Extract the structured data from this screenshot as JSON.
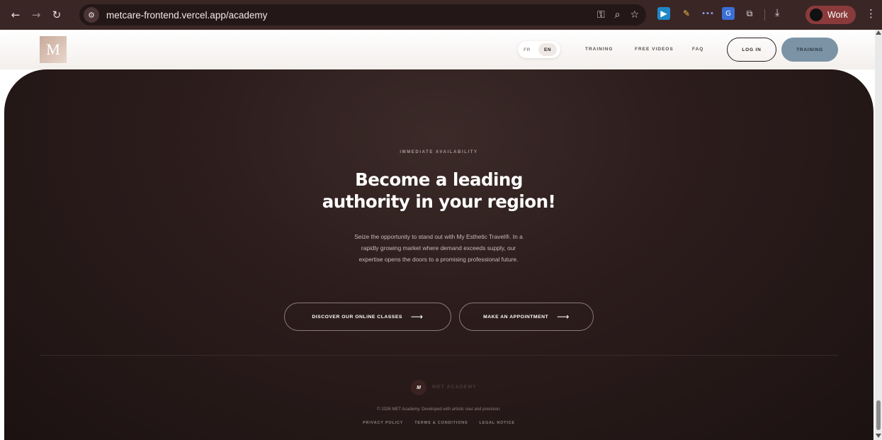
{
  "browser": {
    "url": "metcare-frontend.vercel.app/academy",
    "profile_name": "Work",
    "icons": [
      "back-icon",
      "forward-icon",
      "reload-icon",
      "site-info-icon",
      "password-key-icon",
      "zoom-icon",
      "bookmark-star-icon",
      "extension-icons",
      "download-icon",
      "menu-kebab-icon"
    ]
  },
  "header": {
    "logo_letter": "M",
    "lang": {
      "fr": "FR",
      "en": "EN",
      "active": "EN"
    },
    "nav": {
      "training": "TRAINING",
      "free_videos": "FREE VIDEOS",
      "faq": "FAQ"
    },
    "login": "LOG IN",
    "training_button": "TRAINING"
  },
  "hero": {
    "eyebrow": "IMMEDIATE AVAILABILITY",
    "title_line1": "Become a leading",
    "title_line2": "authority in your region!",
    "description": "Seize the opportunity to stand out with My Esthetic Travel®. In a rapidly growing market where demand exceeds supply, our expertise opens the doors to a promising professional future.",
    "cta_classes": "DISCOVER OUR ONLINE CLASSES",
    "cta_appointment": "MAKE AN APPOINTMENT",
    "arrow": "⟶"
  },
  "footer": {
    "logo_letter": "M",
    "brand": "MET ACADEMY",
    "copyright": "© 2026 MET Academy. Developed with artistic soul and precision.",
    "links": {
      "privacy": "PRIVACY POLICY",
      "terms": "TERMS & CONDITIONS",
      "legal": "LEGAL NOTICE"
    }
  },
  "colors": {
    "hero_bg": "#2c1d1c",
    "training_button_bg": "#7b93a5",
    "chrome_bg": "#3b2626"
  }
}
